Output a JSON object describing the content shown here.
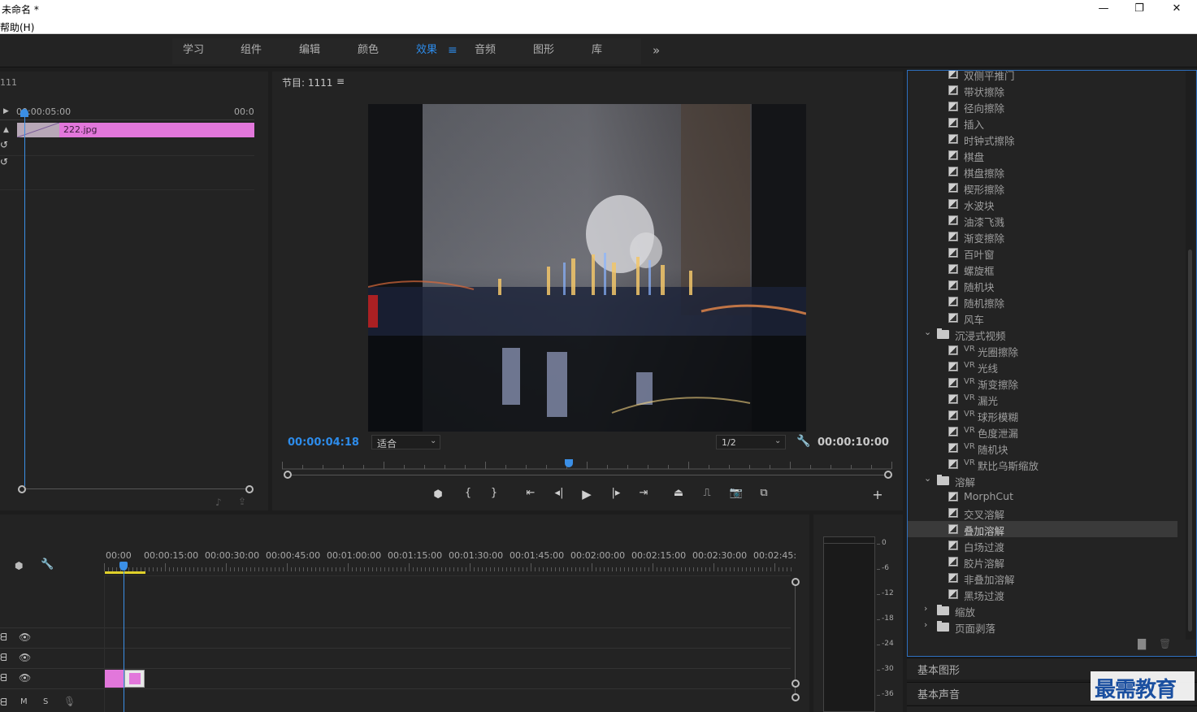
{
  "window": {
    "title": "未命名 *",
    "menu": "帮助(H)",
    "minimize": "—",
    "restore": "❐",
    "close": "✕"
  },
  "workspaces": {
    "tabs": [
      "学习",
      "组件",
      "编辑",
      "颜色",
      "效果",
      "音频",
      "图形",
      "库"
    ],
    "active_menu_icon": "≡",
    "more": "»"
  },
  "source": {
    "label": "111",
    "time_start": "00:00:05:00",
    "time_end": "00:0",
    "clip_name": "222.jpg"
  },
  "program": {
    "title": "节目: 1111",
    "menu_icon": "≡",
    "current_time": "00:00:04:18",
    "fit": "适合",
    "resolution": "1/2",
    "duration": "00:00:10:00",
    "playhead_fraction": 0.47
  },
  "timeline": {
    "ruler": [
      "00:00",
      "00:00:15:00",
      "00:00:30:00",
      "00:00:45:00",
      "00:01:00:00",
      "00:01:15:00",
      "00:01:30:00",
      "00:01:45:00",
      "00:02:00:00",
      "00:02:15:00",
      "00:02:30:00",
      "00:02:45:"
    ],
    "track_labels": {
      "m": "M",
      "s": "S"
    }
  },
  "meter": {
    "scale": [
      "0",
      "-6",
      "-12",
      "-18",
      "-24",
      "-30",
      "-36"
    ]
  },
  "effects": {
    "items_top": [
      "双侧平推门",
      "带状擦除",
      "径向擦除",
      "插入",
      "时钟式擦除",
      "棋盘",
      "棋盘擦除",
      "楔形擦除",
      "水波块",
      "油漆飞溅",
      "渐变擦除",
      "百叶窗",
      "螺旋框",
      "随机块",
      "随机擦除",
      "风车"
    ],
    "folder_immersive": "沉浸式视频",
    "vr_tag": "VR",
    "items_vr": [
      "光圈擦除",
      "光线",
      "渐变擦除",
      "漏光",
      "球形模糊",
      "色度泄漏",
      "随机块",
      "默比乌斯缩放"
    ],
    "folder_dissolve": "溶解",
    "items_dissolve": [
      "MorphCut",
      "交叉溶解",
      "叠加溶解",
      "白场过渡",
      "胶片溶解",
      "非叠加溶解",
      "黑场过渡"
    ],
    "selected": "叠加溶解",
    "folder_zoom": "缩放",
    "folder_page": "页面剥落"
  },
  "panels": {
    "basic_graphics": "基本图形",
    "basic_sound": "基本声音"
  },
  "watermark": "最需教育",
  "colors": {
    "accent": "#2d8ceb",
    "clip": "#e277db",
    "playhead": "#3b8fe6",
    "work_area": "#e0d02a"
  }
}
